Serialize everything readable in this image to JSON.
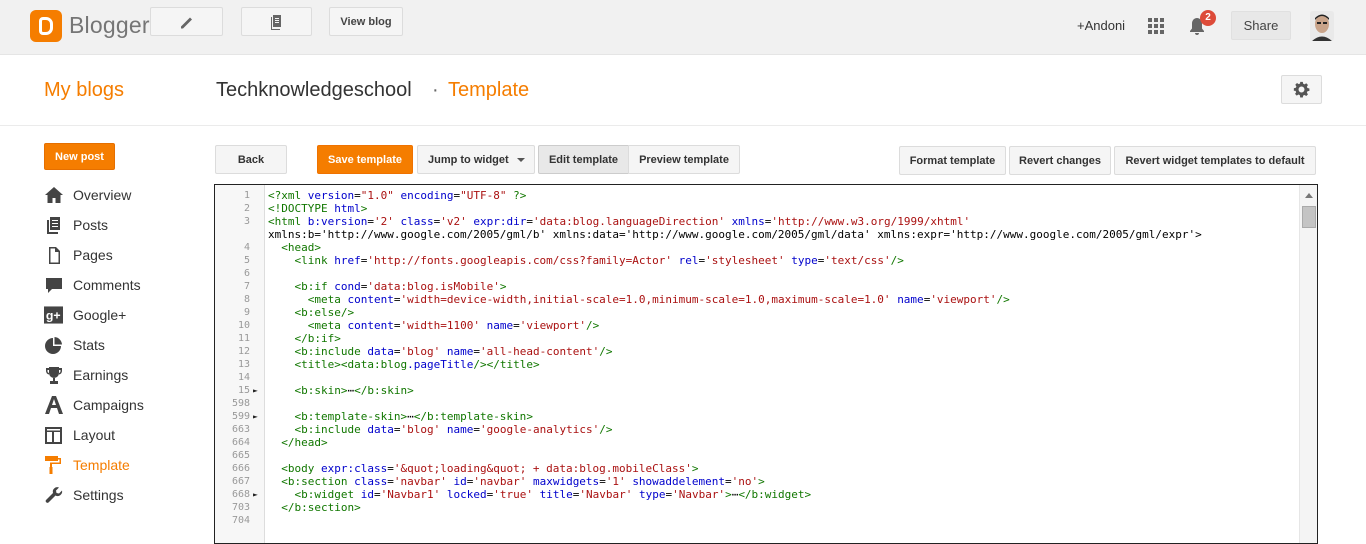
{
  "topbar": {
    "logo_text": "Blogger",
    "view_blog": "View blog",
    "user": "+Andoni",
    "notification_count": "2",
    "share": "Share"
  },
  "header": {
    "my_blogs": "My blogs",
    "blog_name": "Techknowledgeschool",
    "separator": "·",
    "page_title": "Template"
  },
  "sidebar": {
    "new_post": "New post",
    "items": [
      {
        "label": "Overview",
        "icon": "home-icon"
      },
      {
        "label": "Posts",
        "icon": "posts-icon"
      },
      {
        "label": "Pages",
        "icon": "pages-icon"
      },
      {
        "label": "Comments",
        "icon": "comments-icon"
      },
      {
        "label": "Google+",
        "icon": "google-plus-icon"
      },
      {
        "label": "Stats",
        "icon": "stats-icon"
      },
      {
        "label": "Earnings",
        "icon": "trophy-icon"
      },
      {
        "label": "Campaigns",
        "icon": "campaigns-icon"
      },
      {
        "label": "Layout",
        "icon": "layout-icon"
      },
      {
        "label": "Template",
        "icon": "paint-roller-icon",
        "active": true
      },
      {
        "label": "Settings",
        "icon": "wrench-icon"
      }
    ]
  },
  "toolbar": {
    "back": "Back",
    "save": "Save template",
    "jump": "Jump to widget",
    "edit": "Edit template",
    "preview": "Preview template",
    "format": "Format template",
    "revert": "Revert changes",
    "revert_widgets": "Revert widget templates to default"
  },
  "colors": {
    "accent": "#f57d00",
    "badge": "#dd4b39"
  },
  "editor": {
    "lines": [
      {
        "n": "1",
        "fold": "",
        "text": "<?xml version=\"1.0\" encoding=\"UTF-8\" ?>"
      },
      {
        "n": "2",
        "fold": "",
        "text": "<!DOCTYPE html>"
      },
      {
        "n": "3",
        "fold": "",
        "text": "<html b:version='2' class='v2' expr:dir='data:blog.languageDirection' xmlns='http://www.w3.org/1999/xhtml'"
      },
      {
        "n": "",
        "fold": "",
        "text": "xmlns:b='http://www.google.com/2005/gml/b' xmlns:data='http://www.google.com/2005/gml/data' xmlns:expr='http://www.google.com/2005/gml/expr'>"
      },
      {
        "n": "4",
        "fold": "",
        "text": "  <head>"
      },
      {
        "n": "5",
        "fold": "",
        "text": "    <link href='http://fonts.googleapis.com/css?family=Actor' rel='stylesheet' type='text/css'/>"
      },
      {
        "n": "6",
        "fold": "",
        "text": ""
      },
      {
        "n": "7",
        "fold": "",
        "text": "    <b:if cond='data:blog.isMobile'>"
      },
      {
        "n": "8",
        "fold": "",
        "text": "      <meta content='width=device-width,initial-scale=1.0,minimum-scale=1.0,maximum-scale=1.0' name='viewport'/>"
      },
      {
        "n": "9",
        "fold": "",
        "text": "    <b:else/>"
      },
      {
        "n": "10",
        "fold": "",
        "text": "      <meta content='width=1100' name='viewport'/>"
      },
      {
        "n": "11",
        "fold": "",
        "text": "    </b:if>"
      },
      {
        "n": "12",
        "fold": "",
        "text": "    <b:include data='blog' name='all-head-content'/>"
      },
      {
        "n": "13",
        "fold": "",
        "text": "    <title><data:blog.pageTitle/></title>"
      },
      {
        "n": "14",
        "fold": "",
        "text": ""
      },
      {
        "n": "15",
        "fold": "►",
        "text": "    <b:skin>⋯</b:skin>"
      },
      {
        "n": "598",
        "fold": "",
        "text": ""
      },
      {
        "n": "599",
        "fold": "►",
        "text": "    <b:template-skin>⋯</b:template-skin>"
      },
      {
        "n": "663",
        "fold": "",
        "text": "    <b:include data='blog' name='google-analytics'/>"
      },
      {
        "n": "664",
        "fold": "",
        "text": "  </head>"
      },
      {
        "n": "665",
        "fold": "",
        "text": ""
      },
      {
        "n": "666",
        "fold": "",
        "text": "  <body expr:class='&quot;loading&quot; + data:blog.mobileClass'>"
      },
      {
        "n": "667",
        "fold": "",
        "text": "  <b:section class='navbar' id='navbar' maxwidgets='1' showaddelement='no'>"
      },
      {
        "n": "668",
        "fold": "►",
        "text": "    <b:widget id='Navbar1' locked='true' title='Navbar' type='Navbar'>⋯</b:widget>"
      },
      {
        "n": "703",
        "fold": "",
        "text": "  </b:section>"
      },
      {
        "n": "704",
        "fold": "",
        "text": ""
      }
    ]
  }
}
